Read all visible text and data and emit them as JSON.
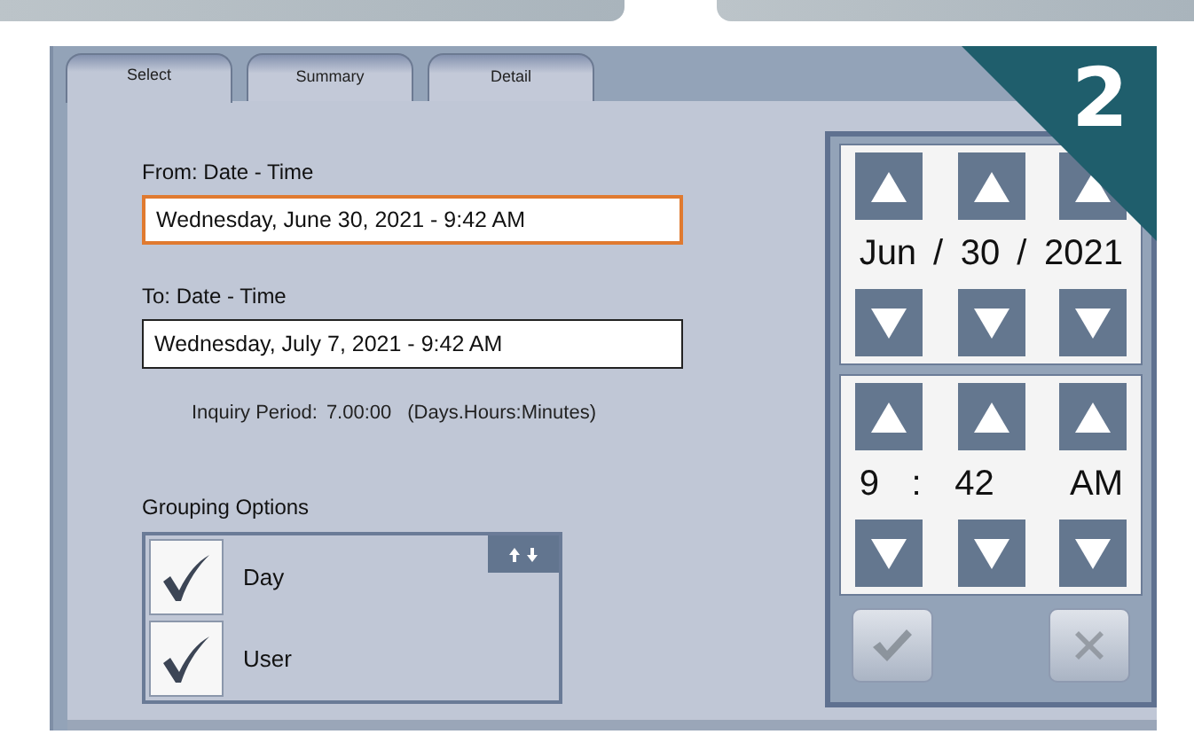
{
  "tabs": [
    {
      "label": "Select",
      "selected": true
    },
    {
      "label": "Summary",
      "selected": false
    },
    {
      "label": "Detail",
      "selected": false
    }
  ],
  "from": {
    "label": "From: Date - Time",
    "value": "Wednesday, June 30, 2021 - 9:42 AM",
    "selected": true
  },
  "to": {
    "label": "To: Date - Time",
    "value": "Wednesday, July 7, 2021 - 9:42 AM",
    "selected": false
  },
  "inquiry_period": {
    "label": "Inquiry Period:",
    "value": "7.00:00",
    "units": "(Days.Hours:Minutes)"
  },
  "grouping": {
    "title": "Grouping Options",
    "options": [
      {
        "label": "Day",
        "checked": true
      },
      {
        "label": "User",
        "checked": true
      }
    ]
  },
  "picker": {
    "date": {
      "fields": [
        "Jun",
        "30",
        "2021"
      ],
      "separators": [
        "/",
        "/"
      ]
    },
    "time": {
      "fields": [
        "9",
        "42",
        "AM"
      ],
      "separators": [
        ":"
      ]
    },
    "ok_button": {
      "disabled": true
    },
    "cancel_button": {
      "disabled": true
    }
  },
  "badge": "2"
}
